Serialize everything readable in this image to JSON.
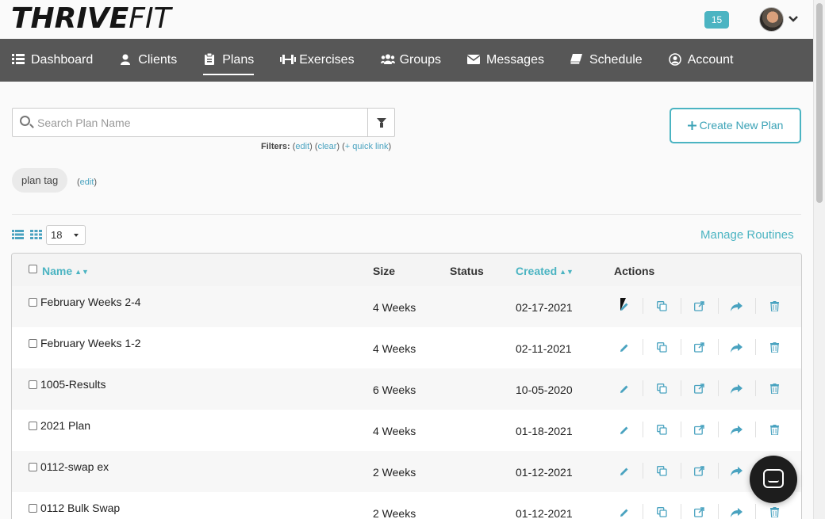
{
  "header": {
    "logo_bold": "THRIVE",
    "logo_thin": "FIT",
    "notification_count": "15"
  },
  "nav": {
    "items": [
      {
        "label": "Dashboard",
        "icon": "list-icon"
      },
      {
        "label": "Clients",
        "icon": "user-icon"
      },
      {
        "label": "Plans",
        "icon": "clipboard-icon"
      },
      {
        "label": "Exercises",
        "icon": "dumbbell-icon"
      },
      {
        "label": "Groups",
        "icon": "users-icon"
      },
      {
        "label": "Messages",
        "icon": "envelope-icon"
      },
      {
        "label": "Schedule",
        "icon": "book-icon"
      },
      {
        "label": "Account",
        "icon": "user-circle-icon"
      }
    ],
    "active": "Plans"
  },
  "search": {
    "placeholder": "Search Plan Name",
    "value": ""
  },
  "filters": {
    "label": "Filters:",
    "edit": "edit",
    "clear": "clear",
    "quick_link": "+ quick link"
  },
  "create_button": "Create New Plan",
  "tag": {
    "label": "plan tag",
    "edit": "edit"
  },
  "per_page": "18",
  "manage_routines": "Manage Routines",
  "table": {
    "columns": {
      "name": "Name",
      "size": "Size",
      "status": "Status",
      "created": "Created",
      "actions": "Actions"
    },
    "rows": [
      {
        "name": "February Weeks 2-4",
        "size": "4 Weeks",
        "status": "",
        "created": "02-17-2021"
      },
      {
        "name": "February Weeks 1-2",
        "size": "4 Weeks",
        "status": "",
        "created": "02-11-2021"
      },
      {
        "name": "1005-Results",
        "size": "6 Weeks",
        "status": "",
        "created": "10-05-2020"
      },
      {
        "name": "2021 Plan",
        "size": "4 Weeks",
        "status": "",
        "created": "01-18-2021"
      },
      {
        "name": "0112-swap ex",
        "size": "2 Weeks",
        "status": "",
        "created": "01-12-2021"
      },
      {
        "name": "0112 Bulk Swap",
        "size": "2 Weeks",
        "status": "",
        "created": "01-12-2021"
      }
    ]
  },
  "colors": {
    "accent": "#4bb4c2",
    "nav_bg": "#575757",
    "link": "#4aa3c0"
  }
}
